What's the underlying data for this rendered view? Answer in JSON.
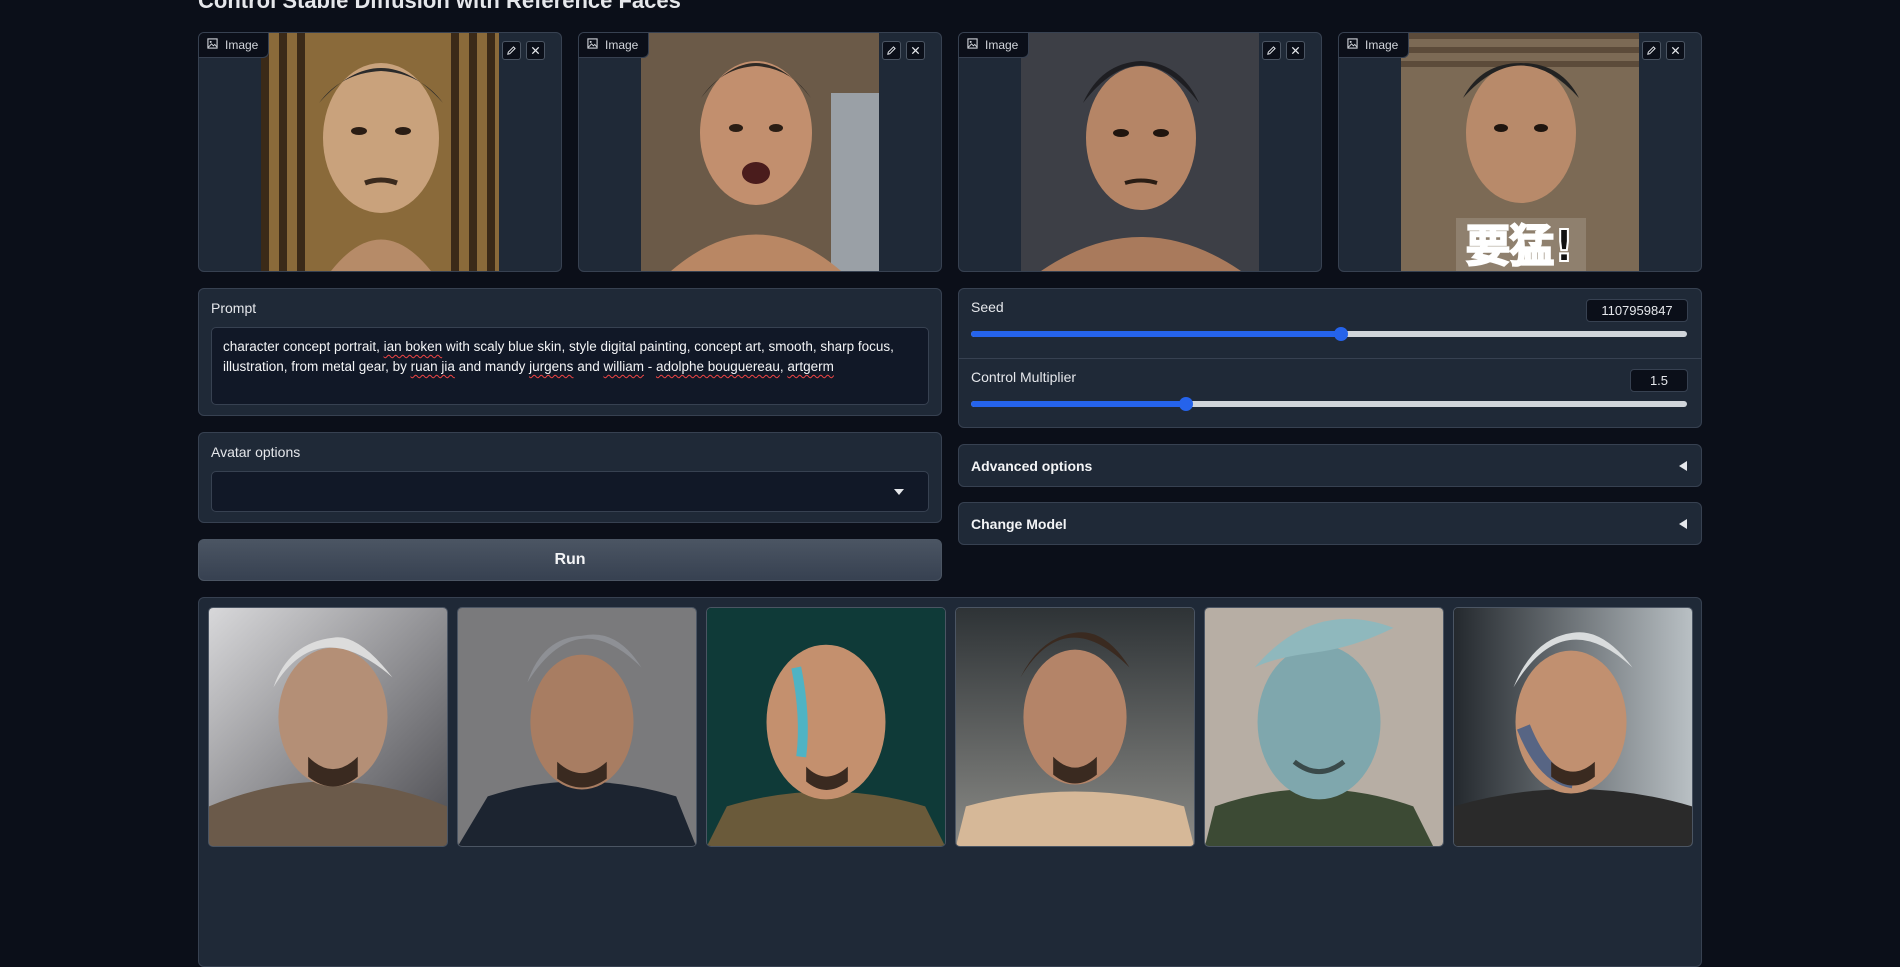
{
  "page": {
    "title": "Control Stable Diffusion with Reference Faces"
  },
  "reference_images": [
    {
      "label": "Image",
      "icon": "image-icon",
      "description_colors": [
        "#8a6a3a",
        "#c9a27c",
        "#2b2b2b"
      ]
    },
    {
      "label": "Image",
      "icon": "image-icon",
      "description_colors": [
        "#6b5a48",
        "#c28f6e",
        "#3a3a3a"
      ]
    },
    {
      "label": "Image",
      "icon": "image-icon",
      "description_colors": [
        "#3d3f46",
        "#b58566",
        "#1e1e22"
      ]
    },
    {
      "label": "Image",
      "icon": "image-icon",
      "description_colors": [
        "#7c6a55",
        "#b88a6a",
        "#222222"
      ]
    }
  ],
  "image_tools": {
    "edit_icon": "pencil-icon",
    "close_icon": "close-icon"
  },
  "prompt": {
    "label": "Prompt",
    "line1_a": "character concept portrait, ",
    "line1_b": "ian boken",
    "line1_c": " with scaly blue skin, style digital painting, concept art, smooth, sharp focus,",
    "line2_a": "illustration, from metal gear, by ",
    "line2_b": "ruan jia",
    "line2_c": " and mandy ",
    "line2_d": "jurgens",
    "line2_e": " and ",
    "line2_f": "william",
    "line2_g": " - ",
    "line2_h": "adolphe bouguereau",
    "line2_i": ", ",
    "line2_j": "artgerm"
  },
  "avatar_options": {
    "label": "Avatar options",
    "selected": ""
  },
  "run_button": {
    "label": "Run"
  },
  "seed": {
    "label": "Seed",
    "value": "1107959847",
    "fraction": 0.517
  },
  "control_multiplier": {
    "label": "Control Multiplier",
    "value": "1.5",
    "fraction": 0.3
  },
  "advanced_options": {
    "label": "Advanced options"
  },
  "change_model": {
    "label": "Change Model"
  },
  "gallery": [
    {
      "name": "result-1"
    },
    {
      "name": "result-2"
    },
    {
      "name": "result-3"
    },
    {
      "name": "result-4"
    },
    {
      "name": "result-5"
    },
    {
      "name": "result-6"
    }
  ],
  "colors": {
    "accent": "#2563eb",
    "background": "#0b0f19",
    "panel": "#1f2937",
    "border": "#374151"
  }
}
